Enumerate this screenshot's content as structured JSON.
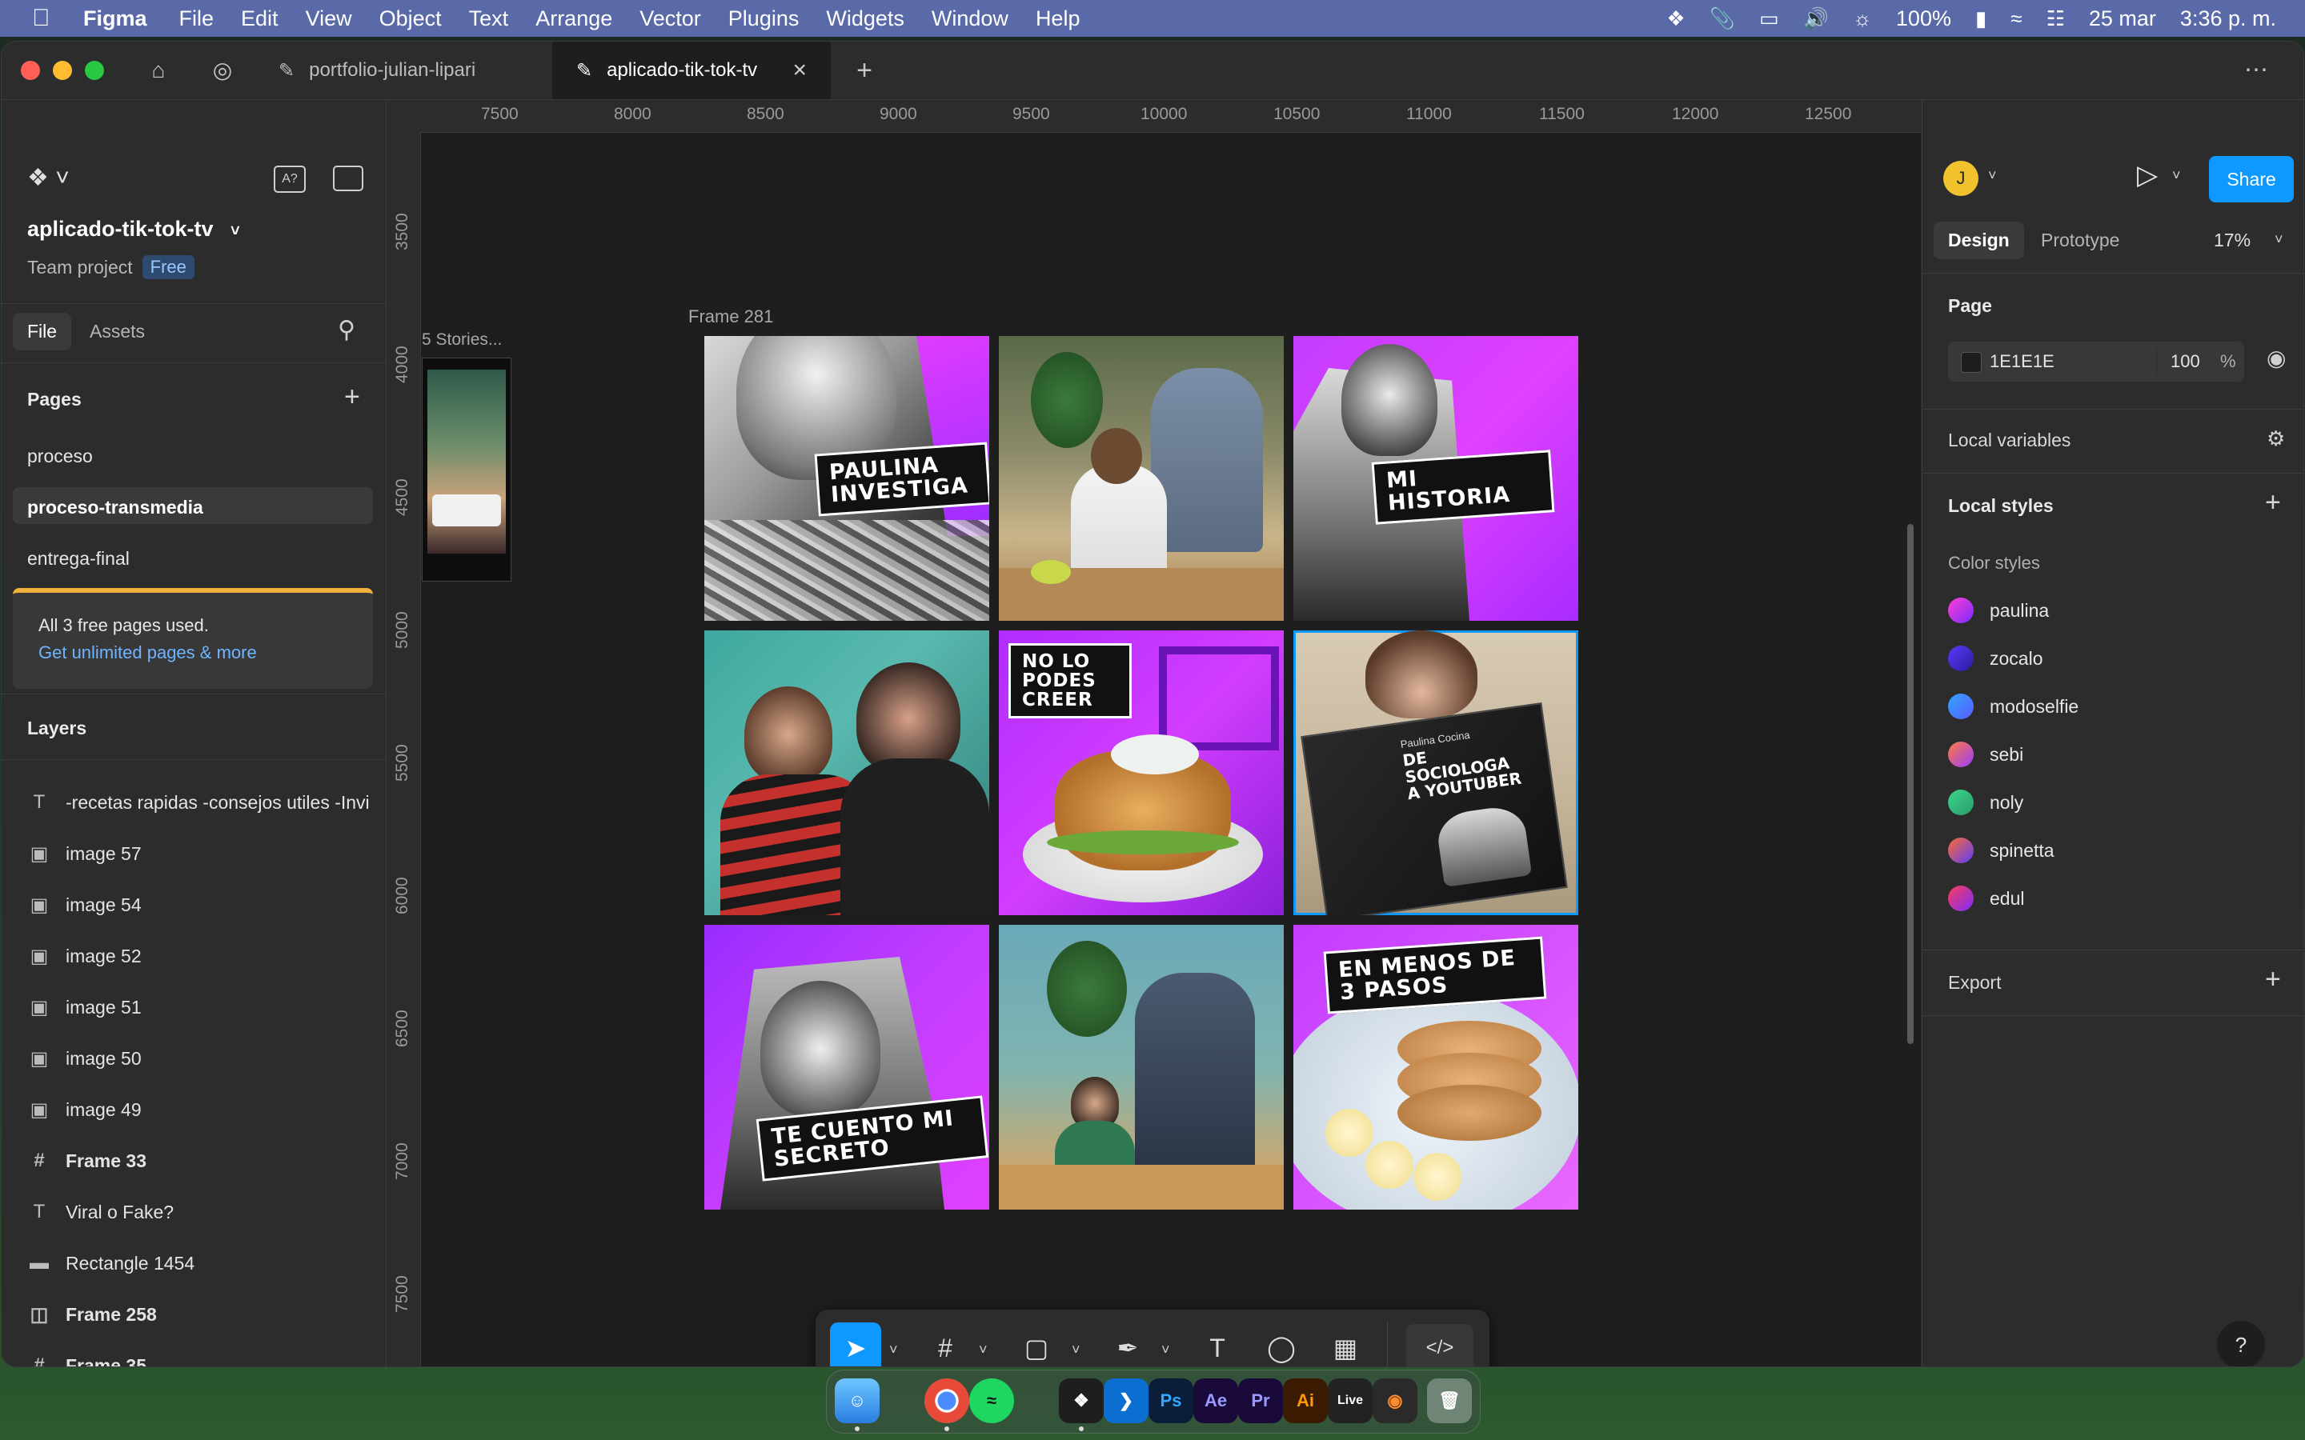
{
  "menubar": {
    "app": "Figma",
    "items": [
      "File",
      "Edit",
      "View",
      "Object",
      "Text",
      "Arrange",
      "Vector",
      "Plugins",
      "Widgets",
      "Window",
      "Help"
    ],
    "battery": "100%",
    "date": "25 mar",
    "time": "3:36 p. m."
  },
  "tabs": [
    {
      "label": "portfolio-julian-lipari"
    },
    {
      "label": "aplicado-tik-tok-tv"
    }
  ],
  "left": {
    "file_name": "aplicado-tik-tok-tv",
    "project": "Team project",
    "plan_badge": "Free",
    "tab_file": "File",
    "tab_assets": "Assets",
    "pages_title": "Pages",
    "pages": [
      "proceso",
      "proceso-transmedia",
      "entrega-final"
    ],
    "upsell_text": "All 3 free pages used.",
    "upsell_link": "Get unlimited pages & more",
    "layers_title": "Layers",
    "layers": [
      {
        "name": "-recetas rapidas -consejos utiles -Invi",
        "icon": "text-icon"
      },
      {
        "name": "image 57",
        "icon": "image-icon"
      },
      {
        "name": "image 54",
        "icon": "image-icon"
      },
      {
        "name": "image 52",
        "icon": "image-icon"
      },
      {
        "name": "image 51",
        "icon": "image-icon"
      },
      {
        "name": "image 50",
        "icon": "image-icon"
      },
      {
        "name": "image 49",
        "icon": "image-icon"
      },
      {
        "name": "Frame 33",
        "icon": "frame-icon"
      },
      {
        "name": "Viral o Fake?",
        "icon": "text-icon"
      },
      {
        "name": "Rectangle 1454",
        "icon": "rectangle-icon"
      },
      {
        "name": "Frame 258",
        "icon": "autolayout-icon"
      },
      {
        "name": "Frame 35",
        "icon": "frame-icon"
      }
    ]
  },
  "canvas": {
    "ruler_x": [
      "7500",
      "8000",
      "8500",
      "9000",
      "9500",
      "10000",
      "10500",
      "11000",
      "11500",
      "12000",
      "12500"
    ],
    "ruler_y": [
      "3500",
      "4000",
      "4500",
      "5000",
      "5500",
      "6000",
      "6500",
      "7000",
      "7500"
    ],
    "side_frame_label": "5 Stories...",
    "frame_label": "Frame 281",
    "stickers": {
      "t1": "PAULINA INVESTIGA",
      "t3": "MI HISTORIA",
      "t5": "NO LO PODES CREER",
      "t6a": "Paulina Cocina",
      "t6b": "DE SOCIOLOGA A YOUTUBER",
      "t7": "TE CUENTO MI SECRETO",
      "t9": "EN MENOS DE 3 PASOS"
    }
  },
  "right": {
    "avatar_initial": "J",
    "share": "Share",
    "tab_design": "Design",
    "tab_prototype": "Prototype",
    "zoom": "17%",
    "page_title": "Page",
    "page_color": "1E1E1E",
    "page_opacity": "100",
    "percent": "%",
    "local_variables": "Local variables",
    "local_styles": "Local styles",
    "color_styles_title": "Color styles",
    "color_styles": [
      {
        "name": "paulina",
        "from": "#ff3fd2",
        "to": "#7a2cff"
      },
      {
        "name": "zocalo",
        "from": "#5a3cff",
        "to": "#2a1a9a"
      },
      {
        "name": "modoselfie",
        "from": "#2fa5ff",
        "to": "#5a5cff"
      },
      {
        "name": "sebi",
        "from": "#ff7a3c",
        "to": "#9c3cff"
      },
      {
        "name": "noly",
        "from": "#3cd68a",
        "to": "#2a9c6a"
      },
      {
        "name": "spinetta",
        "from": "#ff6a2c",
        "to": "#5a3cff"
      },
      {
        "name": "edul",
        "from": "#ff3c5a",
        "to": "#7a2cff"
      }
    ],
    "export": "Export"
  },
  "dock": [
    "Finder",
    "Chrome",
    "Spotify",
    "Figma",
    "VS Code",
    "Ps",
    "Ae",
    "Pr",
    "Ai",
    "Live",
    "Blender",
    "Trash"
  ]
}
